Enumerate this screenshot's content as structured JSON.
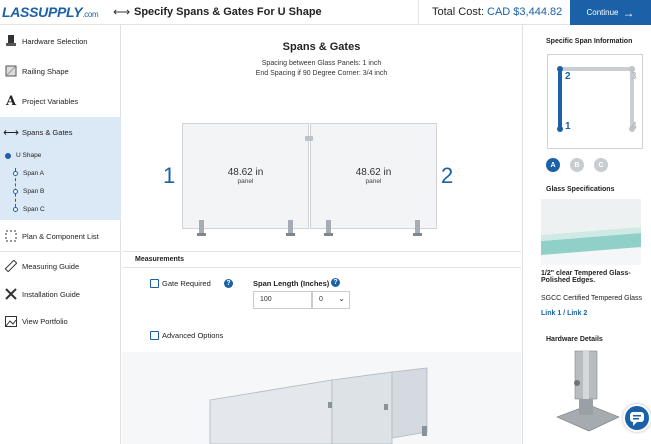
{
  "header": {
    "logo": "LASSUPPLY",
    "logo_suffix": ".com",
    "title": "Specify Spans & Gates For U Shape",
    "total_label": "Total Cost:",
    "total_value": "CAD $3,444.82",
    "continue_label": "Continue"
  },
  "sidebar": {
    "items": [
      {
        "label": "Hardware Selection",
        "icon": "hardware-icon"
      },
      {
        "label": "Railing Shape",
        "icon": "railing-shape-icon"
      },
      {
        "label": "Project Variables",
        "icon": "font-a-icon"
      },
      {
        "label": "Spans & Gates",
        "icon": "double-arrow-icon"
      },
      {
        "label": "Plan & Component List",
        "icon": "dashed-square-icon"
      },
      {
        "label": "Measuring Guide",
        "icon": "ruler-icon"
      },
      {
        "label": "Installation Guide",
        "icon": "tools-icon"
      },
      {
        "label": "View Portfolio",
        "icon": "image-icon"
      }
    ],
    "sub_group": "U Shape",
    "sub_items": [
      "Span A",
      "Span B",
      "Span C"
    ]
  },
  "main": {
    "title": "Spans & Gates",
    "spacing_text": "Spacing between Glass Panels: 1 inch",
    "end_spacing_text": "End Spacing if 90 Degree Corner: 3/4 inch",
    "panels": [
      {
        "value": "48.62 in",
        "unit": "panel"
      },
      {
        "value": "48.62 in",
        "unit": "panel"
      }
    ],
    "corner_left": "1",
    "corner_right": "2",
    "measurements_title": "Measurements",
    "gate_label": "Gate Required",
    "span_length_label": "Span Length (Inches)",
    "span_length_value": "100",
    "fraction_value": "0",
    "advanced_label": "Advanced Options"
  },
  "right": {
    "span_info_title": "Specific Span Information",
    "corners": [
      "1",
      "2",
      "3",
      "4"
    ],
    "selector": [
      "A",
      "B",
      "C"
    ],
    "glass_title": "Glass Specifications",
    "glass_desc": "1/2\" clear Tempered Glass-Polished Edges.",
    "glass_cert": "SGCC Certified Tempered Glass",
    "link1": "Link 1",
    "link_sep": " / ",
    "link2": "Link 2",
    "hardware_title": "Hardware Details"
  },
  "colors": {
    "accent": "#1a61a8",
    "active_bg": "#dbe8f6"
  }
}
